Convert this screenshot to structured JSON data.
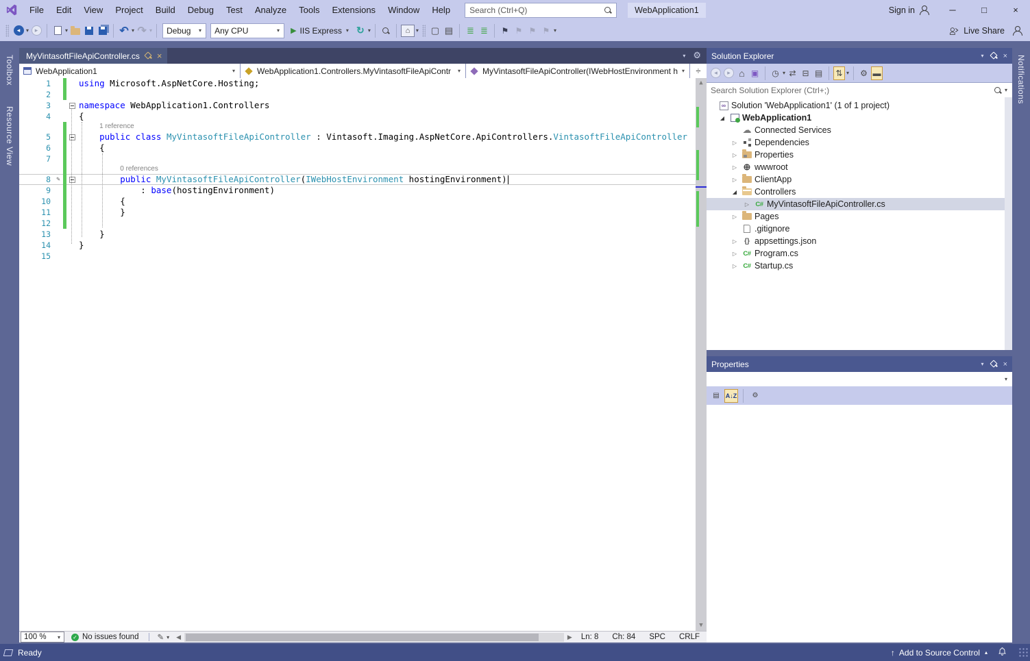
{
  "window": {
    "title_project": "WebApplication1",
    "sign_in_label": "Sign in"
  },
  "menu": {
    "items": [
      "File",
      "Edit",
      "View",
      "Project",
      "Build",
      "Debug",
      "Test",
      "Analyze",
      "Tools",
      "Extensions",
      "Window",
      "Help"
    ],
    "search_placeholder": "Search (Ctrl+Q)"
  },
  "toolbar": {
    "config": "Debug",
    "platform": "Any CPU",
    "run_target": "IIS Express",
    "live_share_label": "Live Share"
  },
  "left_dock_tabs": [
    "Toolbox",
    "Resource View"
  ],
  "right_dock_tabs": [
    "Notifications"
  ],
  "editor": {
    "tab_label": "MyVintasoftFileApiController.cs",
    "breadcrumbs": [
      {
        "label": "WebApplication1",
        "icon": "project-icon"
      },
      {
        "label": "WebApplication1.Controllers.MyVintasoftFileApiContr",
        "icon": "class-icon"
      },
      {
        "label": "MyVintasoftFileApiController(IWebHostEnvironment h",
        "icon": "method-icon"
      }
    ],
    "code_lines": [
      {
        "n": "1",
        "chg": true,
        "seg": [
          [
            "k",
            "using"
          ],
          [
            "p",
            " Microsoft.AspNetCore.Hosting;"
          ]
        ]
      },
      {
        "n": "2",
        "chg": true,
        "seg": []
      },
      {
        "n": "3",
        "box": true,
        "seg": [
          [
            "k",
            "namespace"
          ],
          [
            "p",
            " WebApplication1.Controllers"
          ]
        ]
      },
      {
        "n": "4",
        "seg": [
          [
            "p",
            "{"
          ]
        ]
      },
      {
        "n": "5",
        "chg": true,
        "box": true,
        "lens": "1 reference",
        "lenspad": 4,
        "seg": [
          [
            "p",
            "    "
          ],
          [
            "k",
            "public"
          ],
          [
            "p",
            " "
          ],
          [
            "k",
            "class"
          ],
          [
            "p",
            " "
          ],
          [
            "t",
            "MyVintasoftFileApiController"
          ],
          [
            "p",
            " : Vintasoft.Imaging.AspNetCore.ApiControllers."
          ],
          [
            "t",
            "VintasoftFileApiController"
          ]
        ]
      },
      {
        "n": "6",
        "chg": true,
        "seg": [
          [
            "p",
            "    {"
          ]
        ]
      },
      {
        "n": "7",
        "chg": true,
        "seg": []
      },
      {
        "n": "8",
        "chg": true,
        "box": true,
        "lens": "0 references",
        "lenspad": 8,
        "caretline": true,
        "pen": true,
        "cursor": true,
        "seg": [
          [
            "p",
            "        "
          ],
          [
            "k",
            "public"
          ],
          [
            "p",
            " "
          ],
          [
            "t",
            "MyVintasoftFileApiController"
          ],
          [
            "p",
            "("
          ],
          [
            "t",
            "IWebHostEnvironment"
          ],
          [
            "p",
            " hostingEnvironment)"
          ]
        ]
      },
      {
        "n": "9",
        "chg": true,
        "seg": [
          [
            "p",
            "            : "
          ],
          [
            "k",
            "base"
          ],
          [
            "p",
            "(hostingEnvironment)"
          ]
        ]
      },
      {
        "n": "10",
        "chg": true,
        "seg": [
          [
            "p",
            "        {"
          ]
        ]
      },
      {
        "n": "11",
        "chg": true,
        "seg": [
          [
            "p",
            "        }"
          ]
        ]
      },
      {
        "n": "12",
        "chg": true,
        "seg": []
      },
      {
        "n": "13",
        "seg": [
          [
            "p",
            "    }"
          ]
        ]
      },
      {
        "n": "14",
        "seg": [
          [
            "p",
            "}"
          ]
        ]
      },
      {
        "n": "15",
        "seg": []
      }
    ],
    "bottom_bar": {
      "zoom": "100 %",
      "issues": "No issues found",
      "line": "Ln: 8",
      "column": "Ch: 84",
      "encoding": "SPC",
      "line_ending": "CRLF"
    }
  },
  "solution_explorer": {
    "title": "Solution Explorer",
    "search_placeholder": "Search Solution Explorer (Ctrl+;)",
    "tree": [
      {
        "label": "Solution 'WebApplication1' (1 of 1 project)",
        "icon": "solution",
        "indent": 0,
        "arrow": "none"
      },
      {
        "label": "WebApplication1",
        "icon": "project",
        "indent": 1,
        "arrow": "expanded",
        "bold": true
      },
      {
        "label": "Connected Services",
        "icon": "cloud",
        "indent": 2,
        "arrow": "none"
      },
      {
        "label": "Dependencies",
        "icon": "deps",
        "indent": 2,
        "arrow": "collapsed"
      },
      {
        "label": "Properties",
        "icon": "folder-props",
        "indent": 2,
        "arrow": "collapsed"
      },
      {
        "label": "wwwroot",
        "icon": "globe",
        "indent": 2,
        "arrow": "collapsed"
      },
      {
        "label": "ClientApp",
        "icon": "folder",
        "indent": 2,
        "arrow": "collapsed"
      },
      {
        "label": "Controllers",
        "icon": "folder-open",
        "indent": 2,
        "arrow": "expanded"
      },
      {
        "label": "MyVintasoftFileApiController.cs",
        "icon": "csharp",
        "indent": 3,
        "arrow": "collapsed",
        "selected": true
      },
      {
        "label": "Pages",
        "icon": "folder",
        "indent": 2,
        "arrow": "collapsed"
      },
      {
        "label": ".gitignore",
        "icon": "file",
        "indent": 2,
        "arrow": "none"
      },
      {
        "label": "appsettings.json",
        "icon": "json",
        "indent": 2,
        "arrow": "collapsed"
      },
      {
        "label": "Program.cs",
        "icon": "csharp",
        "indent": 2,
        "arrow": "collapsed"
      },
      {
        "label": "Startup.cs",
        "icon": "csharp",
        "indent": 2,
        "arrow": "collapsed"
      }
    ]
  },
  "properties_panel": {
    "title": "Properties"
  },
  "status_bar": {
    "left": "Ready",
    "source_control": "Add to Source Control"
  },
  "icons": {
    "search": "magnifier",
    "run": "green-play",
    "issues_ok": "green-check",
    "bookmark": "flag",
    "bell": "notification-bell"
  },
  "colors": {
    "keyword": "#0000FF",
    "type": "#2B91AF",
    "line_number": "#2B91AF",
    "change_bar": "#5BC95B",
    "chrome_light": "#C6CBEC",
    "chrome_dark": "#5D6795",
    "status_bar": "#414F87",
    "toggle_gold": "#F7E9B8"
  }
}
